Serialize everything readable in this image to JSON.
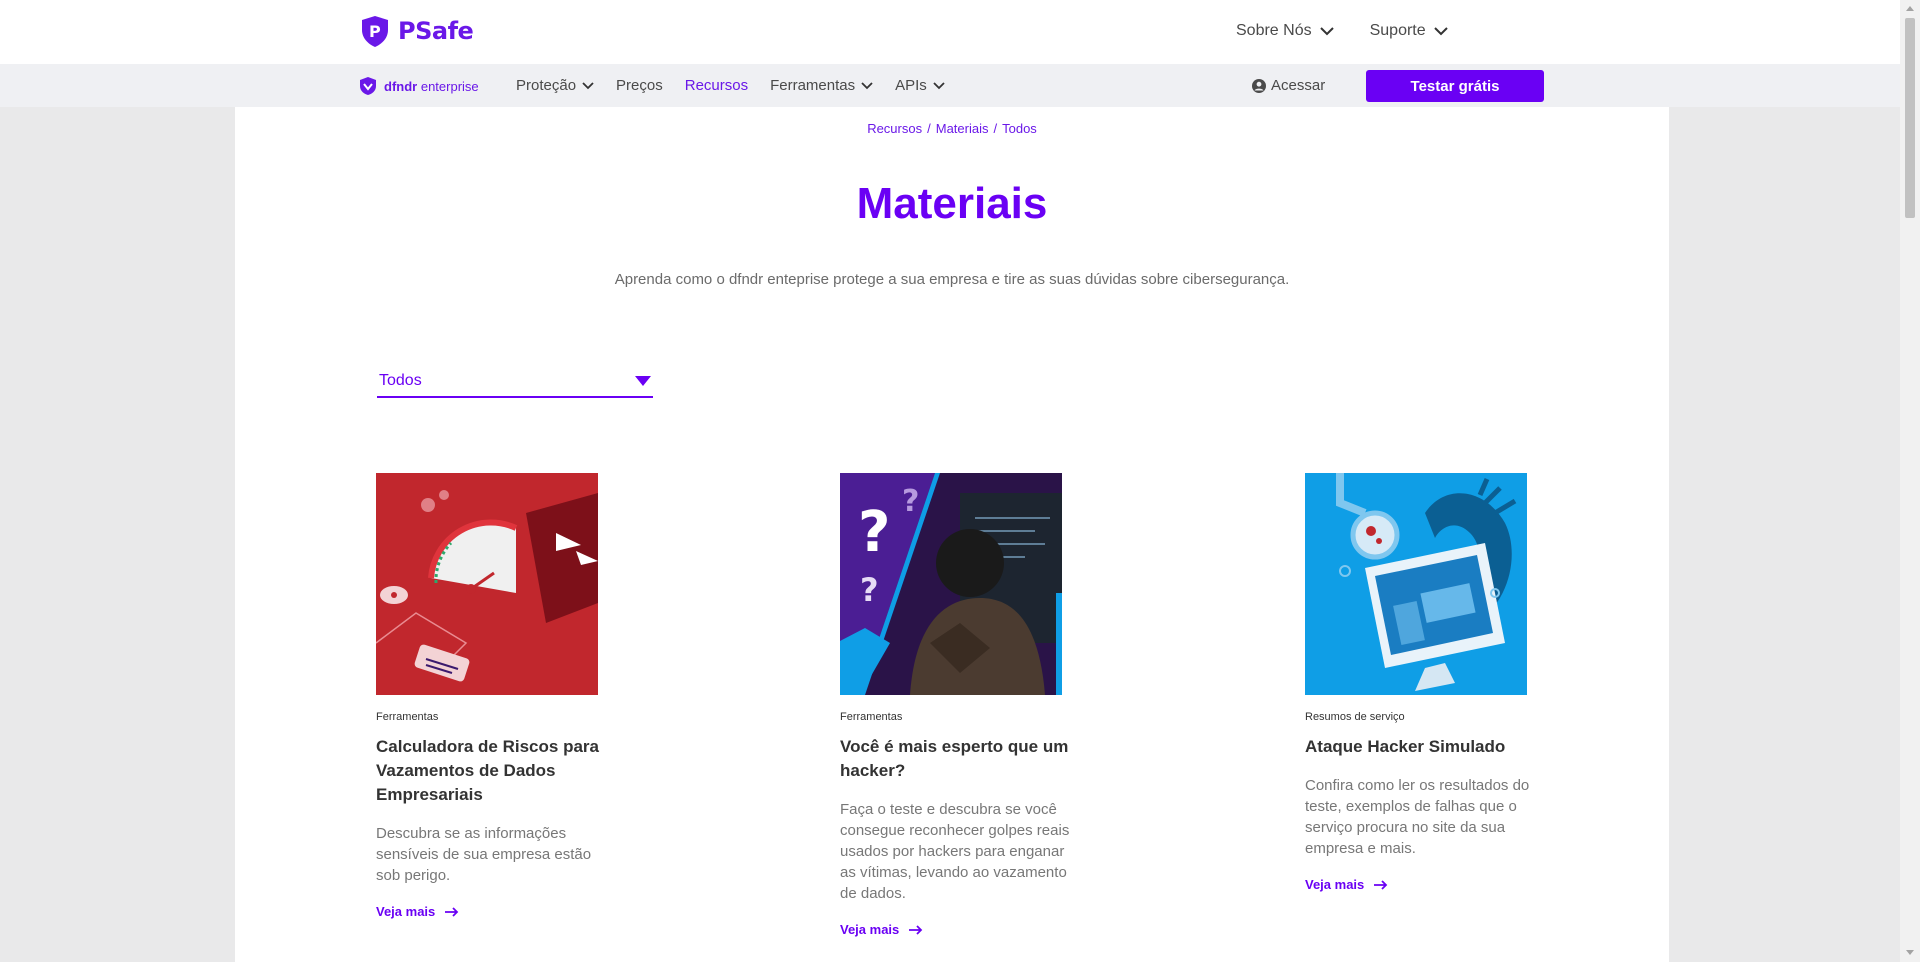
{
  "header": {
    "brand": "PSafe",
    "nav": [
      {
        "label": "Sobre Nós"
      },
      {
        "label": "Suporte"
      }
    ]
  },
  "subnav": {
    "brand_bold": "dfndr",
    "brand_light": "enterprise",
    "items": [
      {
        "label": "Proteção",
        "dropdown": true
      },
      {
        "label": "Preços",
        "dropdown": false
      },
      {
        "label": "Recursos",
        "dropdown": false,
        "active": true
      },
      {
        "label": "Ferramentas",
        "dropdown": true
      },
      {
        "label": "APIs",
        "dropdown": true
      }
    ],
    "login_label": "Acessar",
    "cta_label": "Testar grátis"
  },
  "breadcrumb": [
    "Recursos",
    "Materiais",
    "Todos"
  ],
  "page": {
    "title": "Materiais",
    "subtitle": "Aprenda como o dfndr enteprise protege a sua empresa e tire as suas dúvidas sobre cibersegurança."
  },
  "filter": {
    "selected": "Todos"
  },
  "cards": [
    {
      "tag": "Ferramentas",
      "title": "Calculadora de Riscos para Vazamentos de Dados Empresariais",
      "description": "Descubra se as informações sensíveis de sua empresa estão sob perigo.",
      "link": "Veja mais"
    },
    {
      "tag": "Ferramentas",
      "title": "Você é mais esperto que um hacker?",
      "description": "Faça o teste e descubra se você consegue reconhecer golpes reais usados por hackers para enganar as vítimas, levando ao vazamento de dados.",
      "link": "Veja mais"
    },
    {
      "tag": "Resumos de serviço",
      "title": "Ataque Hacker Simulado",
      "description": "Confira como ler os resultados do teste, exemplos de falhas que o serviço procura no site da sua empresa e mais.",
      "link": "Veja mais"
    }
  ],
  "colors": {
    "brand": "#6a00f4",
    "card1_bg": "#c1272d",
    "card2_bg": "#3b1a6e",
    "card3_bg": "#0f9ee6"
  }
}
